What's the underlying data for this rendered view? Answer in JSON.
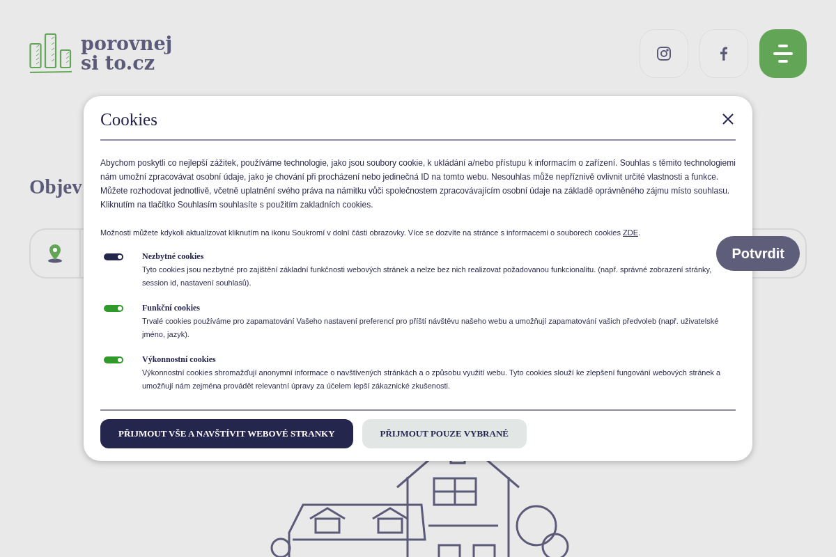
{
  "header": {
    "logo": {
      "line1": "porovnej",
      "line2": "si to.cz"
    },
    "social": [
      {
        "kind": "instagram"
      },
      {
        "kind": "facebook"
      }
    ]
  },
  "hero": {
    "heading": "Objev",
    "search": {
      "button": "Potvrdit"
    }
  },
  "cookie_dialog": {
    "title": "Cookies",
    "intro": "Abychom poskytli co nejlepší zážitek, používáme technologie, jako jsou soubory cookie, k ukládání a/nebo přístupu k informacím o zařízení. Souhlas s těmito technologiemi nám umožní zpracovávat osobní údaje, jako je chování při procházení nebo jedinečná ID na tomto webu. Nesouhlas může nepříznivě ovlivnit určité vlastnosti a funkce. Můžete rozhodovat jednotlivě, včetně uplatnění svého práva na námitku vůči společnostem zpracovávajícím osobní údaje na základě oprávněného zájmu místo souhlasu. Kliknutím na tlačítko Souhlasím souhlasíte s použitím zakladních cookies.",
    "note": "Možnosti můžete kdykoli aktualizovat kliknutím na ikonu Soukromí v dolní části obrazovky. Více se dozvíte na stránce s informacemi o souborech cookies",
    "note_link": "ZDE",
    "note_end": ".",
    "categories": [
      {
        "title": "Nezbytné cookies",
        "description": "Tyto cookies jsou nezbytné pro zajištění základní funkčnosti webových stránek a nelze bez nich realizovat požadovanou funkcionalitu. (např. správné zobrazení stránky, session id, nastavení souhlasů).",
        "checked": true,
        "color": "#25264e"
      },
      {
        "title": "Funkční cookies",
        "description": "Trvalé cookies používáme pro zapamatování Vašeho nastavení preferencí pro příští návštěvu našeho webu a umožňují zapamatování vašich předvoleb (např. uživatelské jméno, jazyk).",
        "checked": true,
        "color": "#2f9a2a"
      },
      {
        "title": "Výkonnostní cookies",
        "description": "Výkonnostní cookies shromažďují anonymní informace o navštívených stránkách a o způsobu využití webu. Tyto cookies slouží ke zlepšení fungování webových stránek a umožňují nám zejména provádět relevantní úpravy za účelem lepší zákaznické zkušenosti.",
        "checked": true,
        "color": "#2f9a2a"
      }
    ],
    "buttons": [
      {
        "label": "PŘIJMOUT VŠE A NAVŠTÍVIT WEBOVÉ STRANKY",
        "kind": "primary"
      },
      {
        "label": "PŘIJMOUT POUZE VYBRANÉ",
        "kind": "secondary"
      }
    ]
  }
}
